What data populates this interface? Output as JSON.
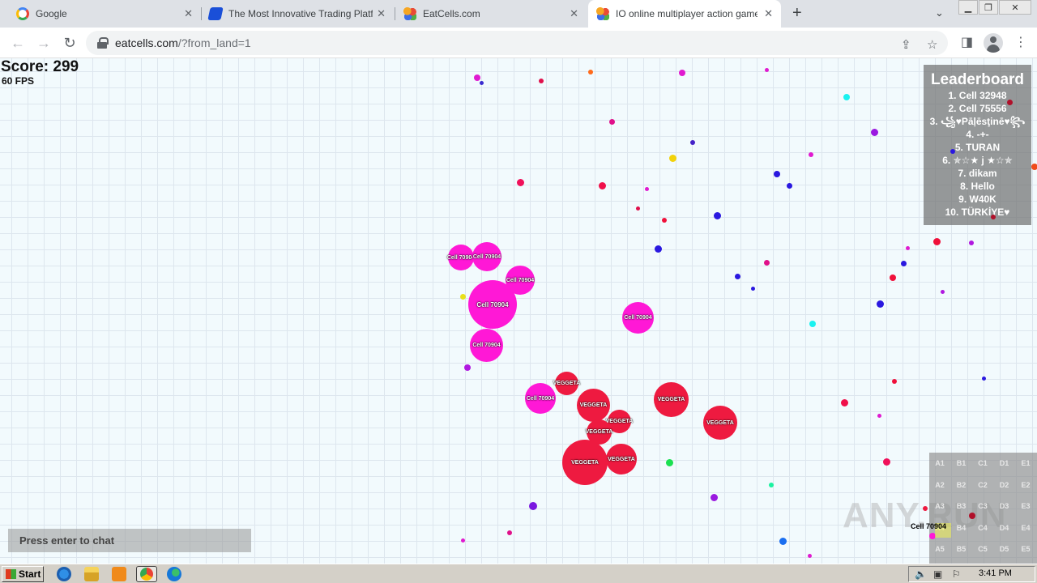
{
  "browser": {
    "tabs": [
      {
        "title": "Google",
        "favicon_color": "#4285f4"
      },
      {
        "title": "The Most Innovative Trading Platform",
        "favicon_color": "#1a4fd8"
      },
      {
        "title": "EatCells.com",
        "favicon_color": "#e94b35"
      },
      {
        "title": "IO online multiplayer action game. Sl",
        "favicon_color": "#e94b35"
      }
    ],
    "active_tab": 3,
    "url_host": "eatcells.com",
    "url_rest": "/?from_land=1"
  },
  "game": {
    "score_label": "Score: 299",
    "fps_label": "60 FPS",
    "chat_placeholder": "Press enter to chat",
    "leaderboard": {
      "title": "Leaderboard",
      "entries": [
        "1. Cell 32948",
        "2. Cell 75556",
        "3. ꧁♥Pāļēsţinē♥꧂",
        "4. -+-",
        "5. TURAN",
        "6. ✯☆★ j ★☆✯",
        "7. dikam",
        "8. Hello",
        "9. W40K",
        "10. TÜRKİYE♥"
      ]
    },
    "player_cell_name": "Cell 70904",
    "enemy_cell_name": "VEGGETA",
    "colors": {
      "player": "#ff18d6",
      "enemy": "#ee1a40"
    },
    "minimap": {
      "cells": [
        "A1",
        "B1",
        "C1",
        "D1",
        "E1",
        "A2",
        "B2",
        "C2",
        "D2",
        "E2",
        "A3",
        "B3",
        "C3",
        "D3",
        "E3",
        "A4",
        "B4",
        "C4",
        "D4",
        "E4",
        "A5",
        "B5",
        "C5",
        "D5",
        "E5"
      ],
      "player_label": "Cell 70904"
    },
    "watermark": "ANY.RUN"
  },
  "taskbar": {
    "start_label": "Start",
    "clock": "3:41 PM"
  }
}
